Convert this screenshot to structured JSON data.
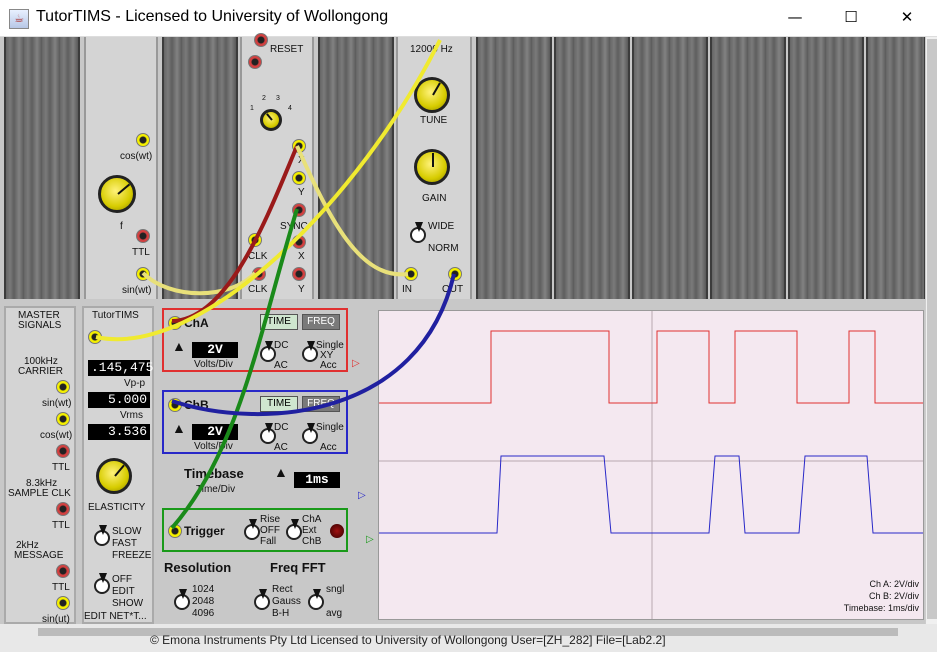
{
  "window": {
    "title": "TutorTIMS - Licensed to University of Wollongong",
    "minimize": "—",
    "maximize": "☐",
    "close": "✕"
  },
  "rack": {
    "sweep_module": {
      "reset": "RESET",
      "dial_ticks": [
        "1",
        "2",
        "3",
        "4"
      ],
      "outputs": [
        "X",
        "Y",
        "SYNC",
        "X",
        "Y"
      ],
      "clk_labels": [
        "CLK",
        "CLK"
      ]
    },
    "tune_module": {
      "freq": "12000 Hz",
      "tune": "TUNE",
      "gain": "GAIN",
      "wide": "WIDE",
      "norm": "NORM",
      "in": "IN",
      "out": "OUT"
    },
    "vco_module": {
      "cos": "cos(wt)",
      "f": "f",
      "ttl": "TTL",
      "sin": "sin(wt)"
    }
  },
  "master": {
    "title1": "MASTER",
    "title2": "SIGNALS",
    "carrier1": "100kHz",
    "carrier2": "CARRIER",
    "sin": "sin(wt)",
    "cos": "cos(wt)",
    "ttl1": "TTL",
    "sample1": "8.3kHz",
    "sample2": "SAMPLE CLK",
    "ttl2": "TTL",
    "msg1": "2kHz",
    "msg2": "MESSAGE",
    "ttl3": "TTL",
    "sin2": "sin(ut)"
  },
  "tutor": {
    "title": "TutorTIMS",
    "freq_value": ".145,475",
    "vpp_label": "Vp-p",
    "vpp_value": "5.000",
    "vrms_label": "Vrms",
    "vrms_value": "3.536",
    "elasticity": "ELASTICITY",
    "slow": "SLOW",
    "fast": "FAST",
    "freeze": "FREEZE",
    "off": "OFF",
    "edit": "EDIT",
    "show": "SHOW",
    "edit_net": "EDIT NET*T..."
  },
  "scope": {
    "cha": {
      "label": "ChA",
      "time": "TIME",
      "freq": "FREQ",
      "volts": "2V",
      "volts_div": "Volts/Div",
      "dc": "DC",
      "ac": "AC",
      "single": "Single",
      "xy": "XY",
      "acc": "Acc"
    },
    "chb": {
      "label": "ChB",
      "time": "TIME",
      "freq": "FREQ",
      "volts": "2V",
      "volts_div": "Volts/Div",
      "dc": "DC",
      "ac": "AC",
      "single": "Single",
      "acc": "Acc"
    },
    "timebase": {
      "label": "Timebase",
      "value": "1ms",
      "time_div": "Time/Div"
    },
    "trigger": {
      "label": "Trigger",
      "rise": "Rise",
      "off": "OFF",
      "fall": "Fall",
      "cha": "ChA",
      "ext": "Ext",
      "chb": "ChB"
    },
    "resolution": {
      "label": "Resolution",
      "opts": [
        "1024",
        "2048",
        "4096"
      ]
    },
    "fft": {
      "label": "Freq FFT",
      "rect": "Rect",
      "gauss": "Gauss",
      "bh": "B-H",
      "sngl": "sngl",
      "avg": "avg"
    },
    "readout": {
      "cha": "Ch A: 2V/div",
      "chb": "Ch B: 2V/div",
      "tb": "Timebase: 1ms/div"
    },
    "colors": {
      "cha": "#e03030",
      "chb": "#2828c8",
      "trig": "#1a9a1a"
    }
  },
  "status": {
    "text": "© Emona Instruments Pty Ltd Licensed to University of Wollongong    User=[ZH_282]    File=[Lab2.2]"
  }
}
